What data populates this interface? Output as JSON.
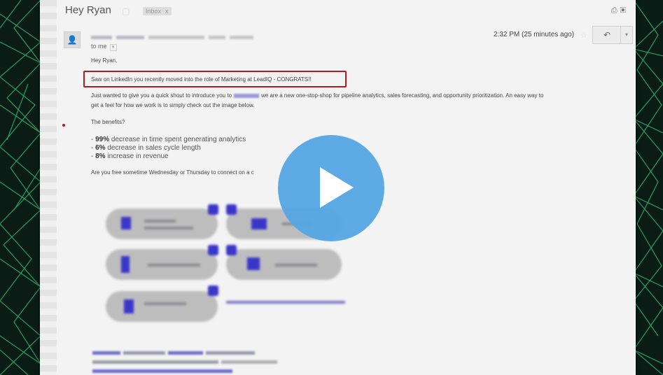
{
  "email": {
    "subject": "Hey Ryan",
    "label": "Inbox",
    "label_close": "x",
    "to_line": "to me",
    "time": "2:32 PM (25 minutes ago)",
    "greeting": "Hey Ryan,",
    "highlighted_line": "Saw on LinkedIn you recently moved into the role of Marketing at LeadIQ - CONGRATS!!",
    "intro_part1": "Just wanted to give you a quick shout to introduce you to",
    "intro_part2": "we are a new one-stop-shop for pipeline analytics, sales forecasting, and opportunity prioritization. An easy way to",
    "intro_line2": "get a feel for how we work is to simply check out the image below.",
    "benefits_heading": "The benefits?",
    "benefits": [
      {
        "value": "99%",
        "text": "decrease in time spent generating analytics"
      },
      {
        "value": "6%",
        "text": "decrease in sales cycle length"
      },
      {
        "value": "8%",
        "text": "increase in revenue"
      }
    ],
    "closing": "Are you free sometime Wednesday or Thursday to connect on a c"
  },
  "icons": {
    "reply": "↶",
    "more": "▾",
    "print": "⎙",
    "star": "☆",
    "avatar": "person-silhouette"
  },
  "colors": {
    "highlight_border": "#b01c22",
    "play_button": "#54a5e4",
    "background_green": "#1fae6a"
  }
}
